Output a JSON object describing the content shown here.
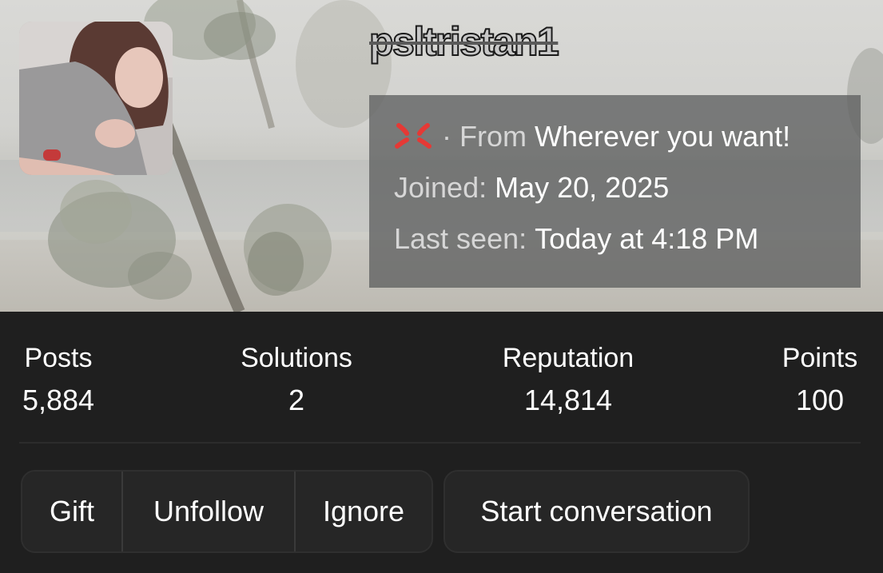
{
  "profile": {
    "username": "psltristan1",
    "location_prefix": "· From ",
    "location": "Wherever you want!",
    "location_icon": "anger-symbol-icon",
    "joined_label": "Joined:",
    "joined_value": "May 20, 2025",
    "last_seen_label": "Last seen:",
    "last_seen_value": "Today at 4:18 PM"
  },
  "stats": [
    {
      "label": "Posts",
      "value": "5,884"
    },
    {
      "label": "Solutions",
      "value": "2"
    },
    {
      "label": "Reputation",
      "value": "14,814"
    },
    {
      "label": "Points",
      "value": "100"
    }
  ],
  "actions": {
    "gift": "Gift",
    "unfollow": "Unfollow",
    "ignore": "Ignore",
    "start_conversation": "Start conversation"
  },
  "colors": {
    "background": "#1f1f1f",
    "button_bg": "#262626",
    "anger_icon": "#e53935"
  }
}
